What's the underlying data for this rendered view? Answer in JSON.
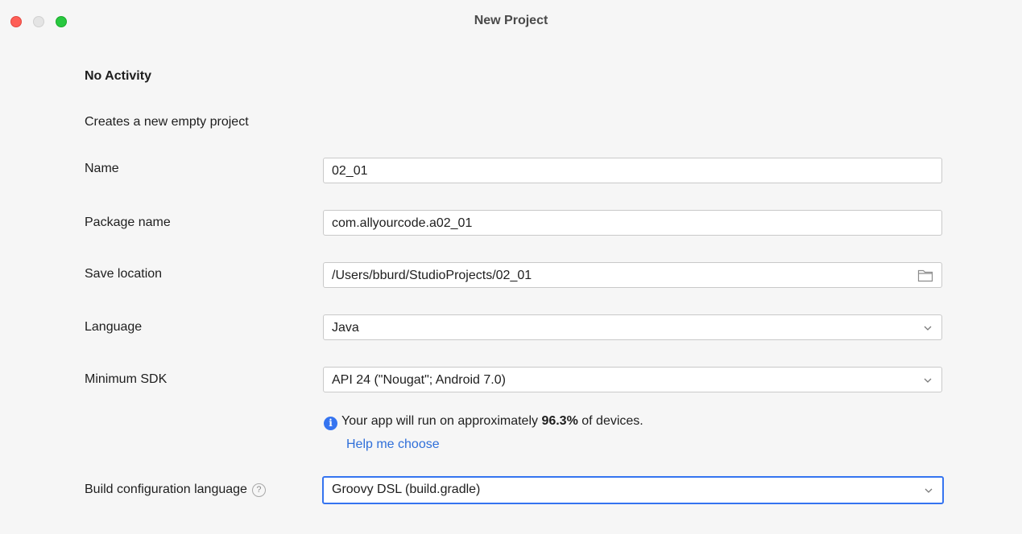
{
  "window": {
    "title": "New Project"
  },
  "template": {
    "heading": "No Activity",
    "description": "Creates a new empty project"
  },
  "form": {
    "name": {
      "label": "Name",
      "value": "02_01"
    },
    "package": {
      "label": "Package name",
      "value": "com.allyourcode.a02_01"
    },
    "location": {
      "label": "Save location",
      "value": "/Users/bburd/StudioProjects/02_01",
      "icon": "folder-icon"
    },
    "language": {
      "label": "Language",
      "value": "Java"
    },
    "min_sdk": {
      "label": "Minimum SDK",
      "value": "API 24 (\"Nougat\"; Android 7.0)"
    },
    "build_config": {
      "label": "Build configuration language",
      "value": "Groovy DSL (build.gradle)",
      "help_icon": "help-question-icon"
    }
  },
  "sdk_info": {
    "icon": "info-icon",
    "prefix": "Your app will run on approximately ",
    "percent": "96.3%",
    "suffix": " of devices.",
    "help_link": "Help me choose"
  },
  "colors": {
    "accent": "#3574f0",
    "close": "#fe5f57",
    "minimize": "#e4e4e4",
    "maximize": "#28c840"
  }
}
